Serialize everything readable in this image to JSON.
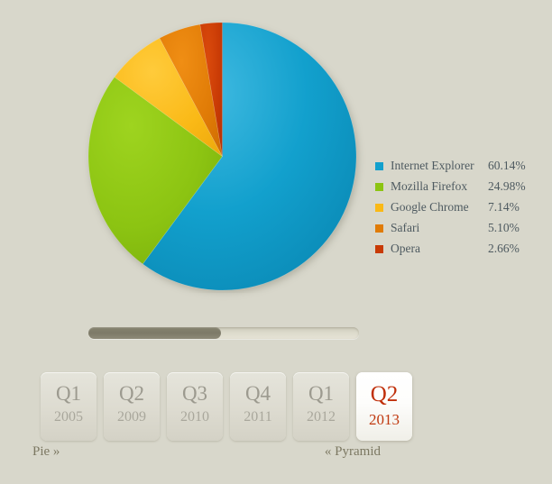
{
  "page": {
    "background_color": "#d8d7cb",
    "text_color": "#4e5a60"
  },
  "chart_data": {
    "type": "pie",
    "title": "",
    "legend_position": "right",
    "start_angle_deg": 0,
    "direction": "clockwise",
    "categories": [
      "Internet Explorer",
      "Mozilla Firefox",
      "Google Chrome",
      "Safari",
      "Opera"
    ],
    "values": [
      60.14,
      24.98,
      7.14,
      5.1,
      2.66
    ],
    "value_labels": [
      "60.14%",
      "24.98%",
      "7.14%",
      "5.10%",
      "2.66%"
    ],
    "unit": "%",
    "colors": [
      "#12a0cd",
      "#8cc412",
      "#fab916",
      "#e07b06",
      "#c83a05"
    ],
    "slices": [
      {
        "label": "Internet Explorer",
        "value": 60.14,
        "display": "60.14%",
        "color": "#12a0cd"
      },
      {
        "label": "Mozilla Firefox",
        "value": 24.98,
        "display": "24.98%",
        "color": "#8cc412"
      },
      {
        "label": "Google Chrome",
        "value": 7.14,
        "display": "7.14%",
        "color": "#fab916"
      },
      {
        "label": "Safari",
        "value": 5.1,
        "display": "5.10%",
        "color": "#e07b06"
      },
      {
        "label": "Opera",
        "value": 2.66,
        "display": "2.66%",
        "color": "#c83a05"
      }
    ]
  },
  "slider": {
    "value_percent": 49,
    "fill_color": "#7d7a68",
    "track_color": "#dcdacb"
  },
  "quarters": [
    {
      "quarter": "Q1",
      "year": "2005",
      "active": false
    },
    {
      "quarter": "Q2",
      "year": "2009",
      "active": false
    },
    {
      "quarter": "Q3",
      "year": "2010",
      "active": false
    },
    {
      "quarter": "Q4",
      "year": "2011",
      "active": false
    },
    {
      "quarter": "Q1",
      "year": "2012",
      "active": false
    },
    {
      "quarter": "Q2",
      "year": "2013",
      "active": true
    }
  ],
  "nav": {
    "prev_label": "Pie »",
    "next_label": "« Pyramid",
    "accent_color": "#c0300b"
  }
}
